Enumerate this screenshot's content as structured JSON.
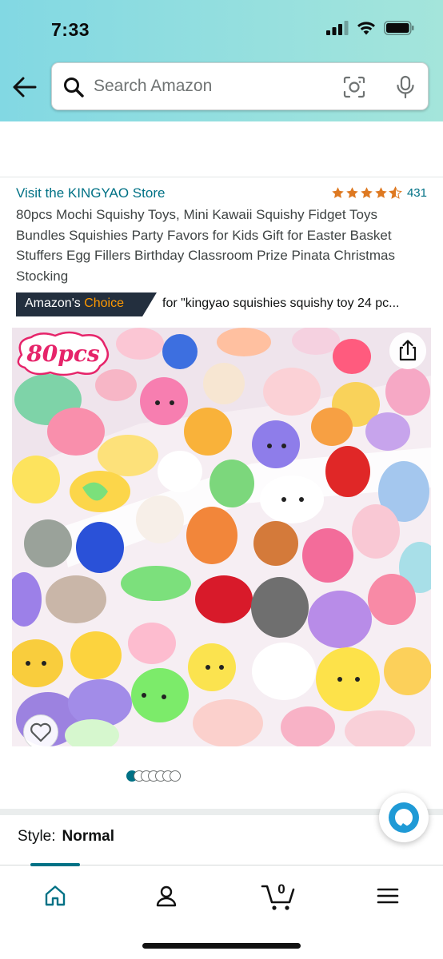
{
  "status_bar": {
    "time": "7:33"
  },
  "header": {
    "search_placeholder": "Search Amazon"
  },
  "product": {
    "store_link": "Visit the KINGYAO Store",
    "rating_stars": 4.5,
    "rating_count": "431",
    "title": "80pcs Mochi Squishy Toys, Mini Kawaii Squishy Fidget Toys Bundles Squishies Party Favors for Kids Gift for Easter Basket Stuffers Egg Fillers Birthday Classroom Prize Pinata Christmas Stocking",
    "choice_badge_prefix": "Amazon's",
    "choice_badge_suffix": "Choice",
    "choice_query": "for \"kingyao squishies squishy toy 24 pc...",
    "image_badge": "80pcs",
    "image_count": 7,
    "active_image_index": 0
  },
  "options": {
    "style_label": "Style:",
    "style_value": "Normal"
  },
  "bottom_nav": {
    "cart_count": "0",
    "items": [
      "home-icon",
      "account-icon",
      "cart-icon",
      "menu-icon"
    ]
  },
  "colors": {
    "link": "#007185",
    "star": "#de7921",
    "badge_bg": "#232f3e",
    "badge_accent": "#ff9900",
    "header_gradient_start": "#82d8e3",
    "header_gradient_end": "#a4e5db"
  }
}
